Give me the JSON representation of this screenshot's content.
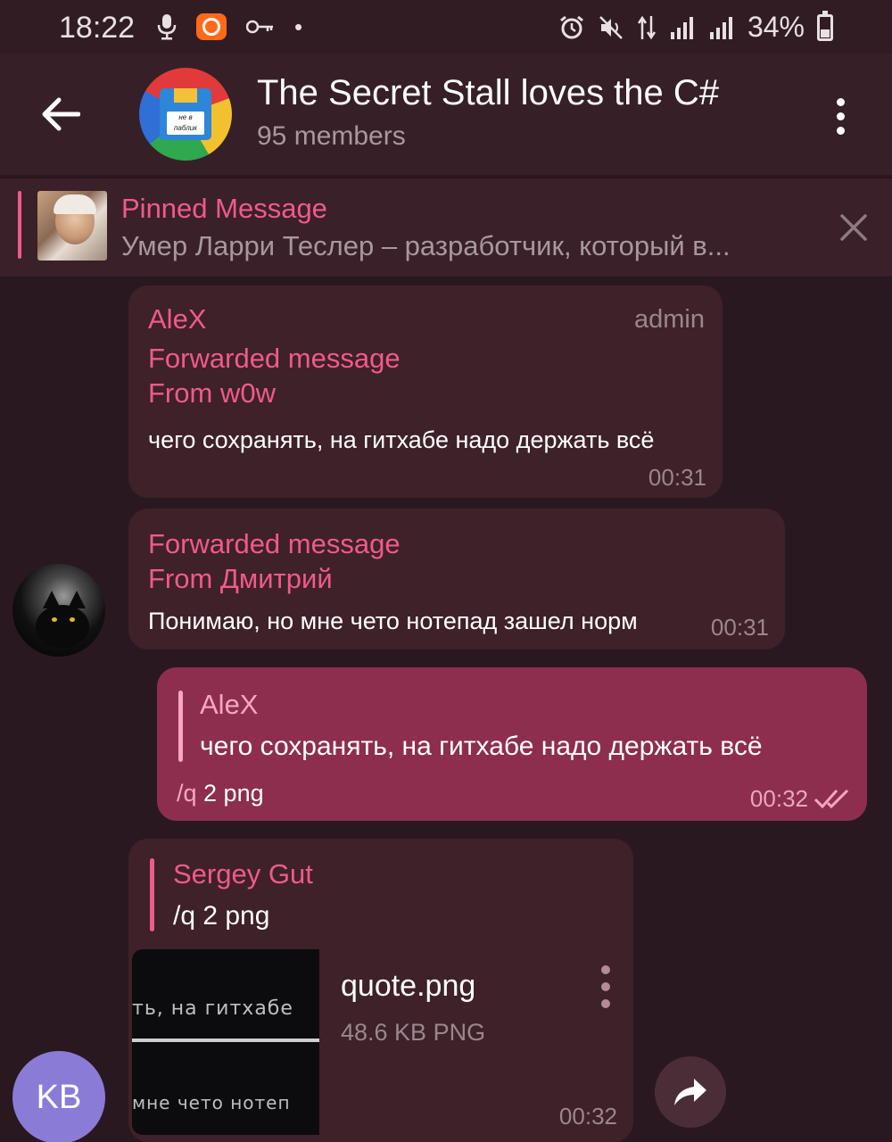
{
  "status_bar": {
    "time": "18:22",
    "battery_percent": "34%",
    "battery_level": 0.34,
    "left_icons": [
      "mic-icon",
      "mi-app-icon",
      "key-icon",
      "dot-icon"
    ],
    "right_icons": [
      "alarm-icon",
      "mute-icon",
      "data-arrows-icon",
      "signal-icon",
      "signal-icon",
      "battery-icon"
    ],
    "dot": "•"
  },
  "header": {
    "title": "The Secret Stall loves the C#",
    "members": "95 members",
    "avatar_label": "не в паблик"
  },
  "pinned": {
    "title": "Pinned Message",
    "text": "Умер Ларри Теслер – разработчик, который в..."
  },
  "messages": [
    {
      "sender": "AleX",
      "tag": "admin",
      "forward_label": "Forwarded message",
      "forward_from": "From w0w",
      "text": "чего сохранять, на гитхабе надо держать всё",
      "time": "00:31"
    },
    {
      "forward_label": "Forwarded message",
      "forward_from": "From Дмитрий",
      "text": "Понимаю, но мне чето нотепад зашел норм",
      "time": "00:31"
    },
    {
      "reply_sender": "AleX",
      "reply_text": "чего сохранять, на гитхабе надо держать всё",
      "command": "/q",
      "text": " 2 png",
      "time": "00:32"
    },
    {
      "reply_sender": "Sergey Gut",
      "reply_text": "/q 2 png",
      "file_name": "quote.png",
      "file_size": "48.6 KB PNG",
      "time": "00:32",
      "thumb_line1": "ть, на гитхабе",
      "thumb_line2": "мне чето нотеп"
    }
  ],
  "bottom_avatar": "KB",
  "colors": {
    "accent": "#f05a8a",
    "outgoing_bubble": "#8e2e4e",
    "incoming_bubble": "#3e2129",
    "background": "#2a1820"
  }
}
